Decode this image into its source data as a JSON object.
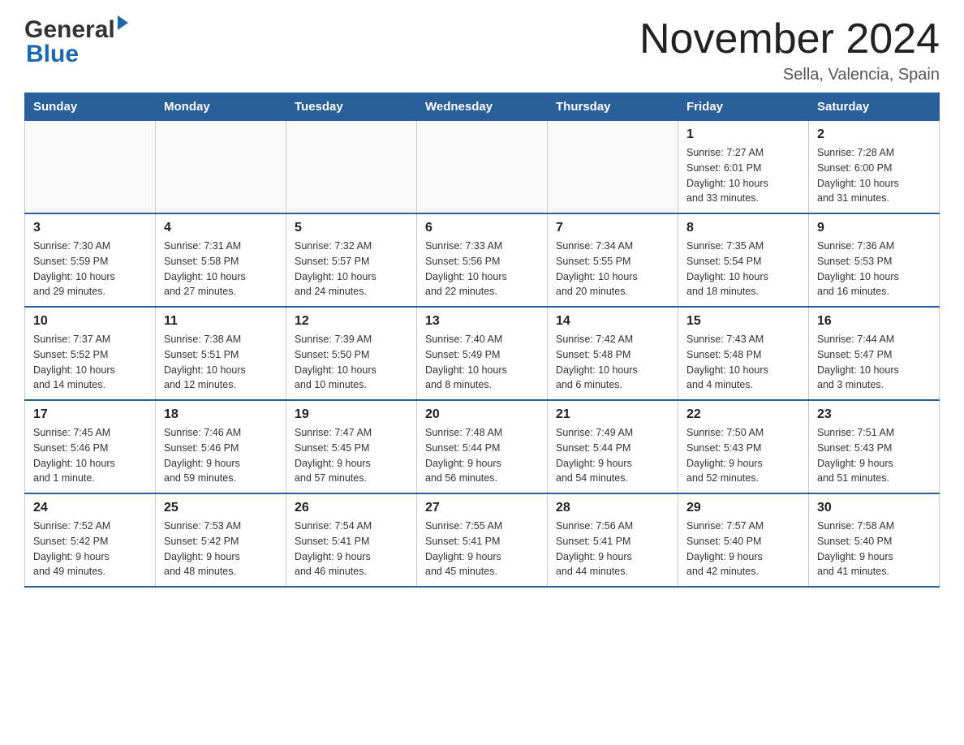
{
  "logo": {
    "general": "General",
    "blue": "Blue"
  },
  "title": "November 2024",
  "location": "Sella, Valencia, Spain",
  "weekdays": [
    "Sunday",
    "Monday",
    "Tuesday",
    "Wednesday",
    "Thursday",
    "Friday",
    "Saturday"
  ],
  "weeks": [
    [
      {
        "day": "",
        "info": ""
      },
      {
        "day": "",
        "info": ""
      },
      {
        "day": "",
        "info": ""
      },
      {
        "day": "",
        "info": ""
      },
      {
        "day": "",
        "info": ""
      },
      {
        "day": "1",
        "info": "Sunrise: 7:27 AM\nSunset: 6:01 PM\nDaylight: 10 hours\nand 33 minutes."
      },
      {
        "day": "2",
        "info": "Sunrise: 7:28 AM\nSunset: 6:00 PM\nDaylight: 10 hours\nand 31 minutes."
      }
    ],
    [
      {
        "day": "3",
        "info": "Sunrise: 7:30 AM\nSunset: 5:59 PM\nDaylight: 10 hours\nand 29 minutes."
      },
      {
        "day": "4",
        "info": "Sunrise: 7:31 AM\nSunset: 5:58 PM\nDaylight: 10 hours\nand 27 minutes."
      },
      {
        "day": "5",
        "info": "Sunrise: 7:32 AM\nSunset: 5:57 PM\nDaylight: 10 hours\nand 24 minutes."
      },
      {
        "day": "6",
        "info": "Sunrise: 7:33 AM\nSunset: 5:56 PM\nDaylight: 10 hours\nand 22 minutes."
      },
      {
        "day": "7",
        "info": "Sunrise: 7:34 AM\nSunset: 5:55 PM\nDaylight: 10 hours\nand 20 minutes."
      },
      {
        "day": "8",
        "info": "Sunrise: 7:35 AM\nSunset: 5:54 PM\nDaylight: 10 hours\nand 18 minutes."
      },
      {
        "day": "9",
        "info": "Sunrise: 7:36 AM\nSunset: 5:53 PM\nDaylight: 10 hours\nand 16 minutes."
      }
    ],
    [
      {
        "day": "10",
        "info": "Sunrise: 7:37 AM\nSunset: 5:52 PM\nDaylight: 10 hours\nand 14 minutes."
      },
      {
        "day": "11",
        "info": "Sunrise: 7:38 AM\nSunset: 5:51 PM\nDaylight: 10 hours\nand 12 minutes."
      },
      {
        "day": "12",
        "info": "Sunrise: 7:39 AM\nSunset: 5:50 PM\nDaylight: 10 hours\nand 10 minutes."
      },
      {
        "day": "13",
        "info": "Sunrise: 7:40 AM\nSunset: 5:49 PM\nDaylight: 10 hours\nand 8 minutes."
      },
      {
        "day": "14",
        "info": "Sunrise: 7:42 AM\nSunset: 5:48 PM\nDaylight: 10 hours\nand 6 minutes."
      },
      {
        "day": "15",
        "info": "Sunrise: 7:43 AM\nSunset: 5:48 PM\nDaylight: 10 hours\nand 4 minutes."
      },
      {
        "day": "16",
        "info": "Sunrise: 7:44 AM\nSunset: 5:47 PM\nDaylight: 10 hours\nand 3 minutes."
      }
    ],
    [
      {
        "day": "17",
        "info": "Sunrise: 7:45 AM\nSunset: 5:46 PM\nDaylight: 10 hours\nand 1 minute."
      },
      {
        "day": "18",
        "info": "Sunrise: 7:46 AM\nSunset: 5:46 PM\nDaylight: 9 hours\nand 59 minutes."
      },
      {
        "day": "19",
        "info": "Sunrise: 7:47 AM\nSunset: 5:45 PM\nDaylight: 9 hours\nand 57 minutes."
      },
      {
        "day": "20",
        "info": "Sunrise: 7:48 AM\nSunset: 5:44 PM\nDaylight: 9 hours\nand 56 minutes."
      },
      {
        "day": "21",
        "info": "Sunrise: 7:49 AM\nSunset: 5:44 PM\nDaylight: 9 hours\nand 54 minutes."
      },
      {
        "day": "22",
        "info": "Sunrise: 7:50 AM\nSunset: 5:43 PM\nDaylight: 9 hours\nand 52 minutes."
      },
      {
        "day": "23",
        "info": "Sunrise: 7:51 AM\nSunset: 5:43 PM\nDaylight: 9 hours\nand 51 minutes."
      }
    ],
    [
      {
        "day": "24",
        "info": "Sunrise: 7:52 AM\nSunset: 5:42 PM\nDaylight: 9 hours\nand 49 minutes."
      },
      {
        "day": "25",
        "info": "Sunrise: 7:53 AM\nSunset: 5:42 PM\nDaylight: 9 hours\nand 48 minutes."
      },
      {
        "day": "26",
        "info": "Sunrise: 7:54 AM\nSunset: 5:41 PM\nDaylight: 9 hours\nand 46 minutes."
      },
      {
        "day": "27",
        "info": "Sunrise: 7:55 AM\nSunset: 5:41 PM\nDaylight: 9 hours\nand 45 minutes."
      },
      {
        "day": "28",
        "info": "Sunrise: 7:56 AM\nSunset: 5:41 PM\nDaylight: 9 hours\nand 44 minutes."
      },
      {
        "day": "29",
        "info": "Sunrise: 7:57 AM\nSunset: 5:40 PM\nDaylight: 9 hours\nand 42 minutes."
      },
      {
        "day": "30",
        "info": "Sunrise: 7:58 AM\nSunset: 5:40 PM\nDaylight: 9 hours\nand 41 minutes."
      }
    ]
  ]
}
